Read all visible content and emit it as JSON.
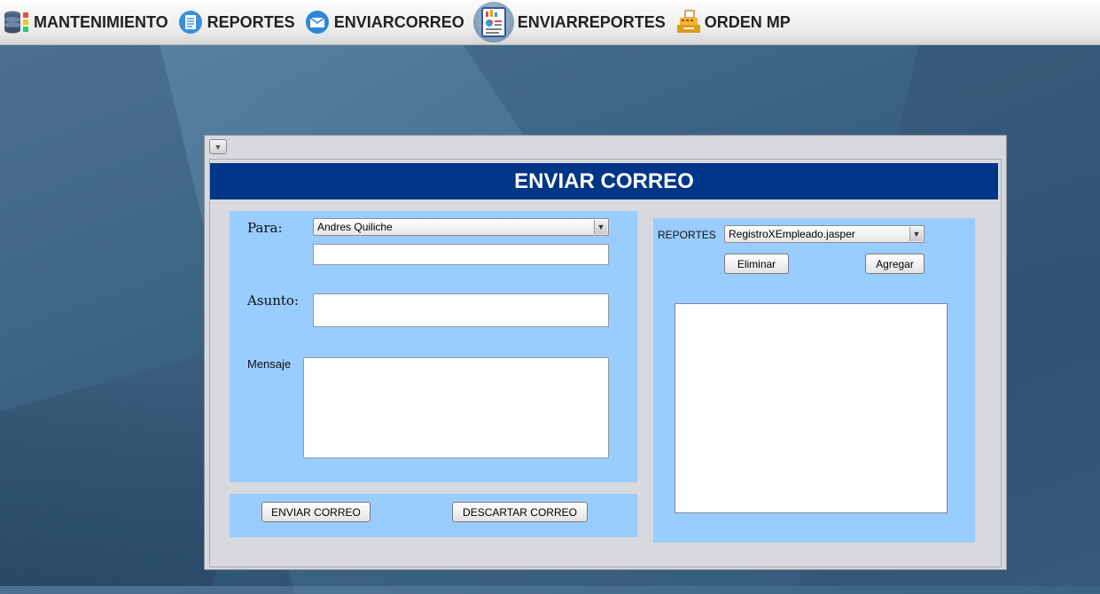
{
  "menu": [
    {
      "label": "MANTENIMIENTO",
      "icon": "database-icon"
    },
    {
      "label": "REPORTES",
      "icon": "document-icon"
    },
    {
      "label": "ENVIARCORREO",
      "icon": "envelope-icon"
    },
    {
      "label": "ENVIARREPORTES",
      "icon": "report-chart-icon"
    },
    {
      "label": "ORDEN MP",
      "icon": "cash-register-icon"
    }
  ],
  "window": {
    "title": "ENVIAR CORREO",
    "menu_button": "▼"
  },
  "form": {
    "para_label": "Para:",
    "para_selected": "Andres Quiliche",
    "para_extra_value": "",
    "asunto_label": "Asunto:",
    "asunto_value": "",
    "mensaje_label": "Mensaje",
    "mensaje_value": "",
    "send_button": "ENVIAR CORREO",
    "discard_button": "DESCARTAR CORREO"
  },
  "reports": {
    "label": "REPORTES",
    "selected": "RegistroXEmpleado.jasper",
    "remove_button": "Eliminar",
    "add_button": "Agregar",
    "list_items": []
  },
  "colors": {
    "title_bar": "#003687",
    "panel": "#99ccff",
    "frame": "#d7d9de"
  }
}
